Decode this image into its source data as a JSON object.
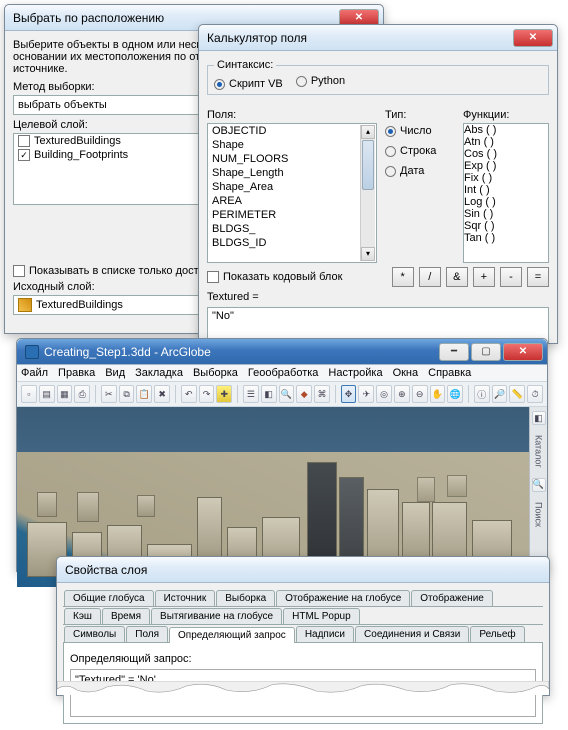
{
  "select_by_location": {
    "title": "Выбрать по расположению",
    "instruction": "Выберите объекты в одном или нескольких целевых слоях на основании их местоположения по отношению к объектам в слое-источнике.",
    "method_label": "Метод выборки:",
    "method_value": "выбрать объекты",
    "target_label": "Целевой слой:",
    "layers": [
      {
        "name": "TexturedBuildings",
        "checked": false
      },
      {
        "name": "Building_Footprints",
        "checked": true
      }
    ],
    "only_selectable_label": "Показывать в списке только доступные для выборки слои",
    "source_label": "Исходный слой:",
    "source_value": "TexturedBuildings"
  },
  "field_calculator": {
    "title": "Калькулятор поля",
    "syntax_label": "Синтаксис:",
    "syntax_vb": "Скрипт VB",
    "syntax_py": "Python",
    "fields_label": "Поля:",
    "fields": [
      "OBJECTID",
      "Shape",
      "NUM_FLOORS",
      "Shape_Length",
      "Shape_Area",
      "AREA",
      "PERIMETER",
      "BLDGS_",
      "BLDGS_ID"
    ],
    "type_label": "Тип:",
    "type_number": "Число",
    "type_string": "Строка",
    "type_date": "Дата",
    "functions_label": "Функции:",
    "functions": [
      "Abs ( )",
      "Atn ( )",
      "Cos ( )",
      "Exp ( )",
      "Fix ( )",
      "Int ( )",
      "Log ( )",
      "Sin ( )",
      "Sqr ( )",
      "Tan ( )"
    ],
    "code_block_label": "Показать кодовый блок",
    "expr_lhs": "Textured =",
    "expr_value": "\"No\"",
    "ops": [
      "*",
      "/",
      "&",
      "+",
      "-",
      "="
    ]
  },
  "arcglobe": {
    "title": "Creating_Step1.3dd - ArcGlobe",
    "menus": [
      "Файл",
      "Правка",
      "Вид",
      "Закладка",
      "Выборка",
      "Геообработка",
      "Настройка",
      "Окна",
      "Справка"
    ],
    "side_tabs": [
      "Каталог",
      "Поиск"
    ]
  },
  "layer_props": {
    "title": "Свойства слоя",
    "tabs_row_top": [
      "Общие глобуса",
      "Источник",
      "Выборка",
      "Отображение на глобусе",
      "Отображение"
    ],
    "tabs_row_mid": [
      "Кэш",
      "Время",
      "Вытягивание на глобусе",
      "HTML Popup"
    ],
    "tabs_row_bot": [
      "Символы",
      "Поля",
      "Определяющий запрос",
      "Надписи",
      "Соединения и Связи",
      "Рельеф"
    ],
    "active_tab": "Определяющий запрос",
    "query_label": "Определяющий запрос:",
    "query_value": "\"Textured\" = 'No'"
  }
}
